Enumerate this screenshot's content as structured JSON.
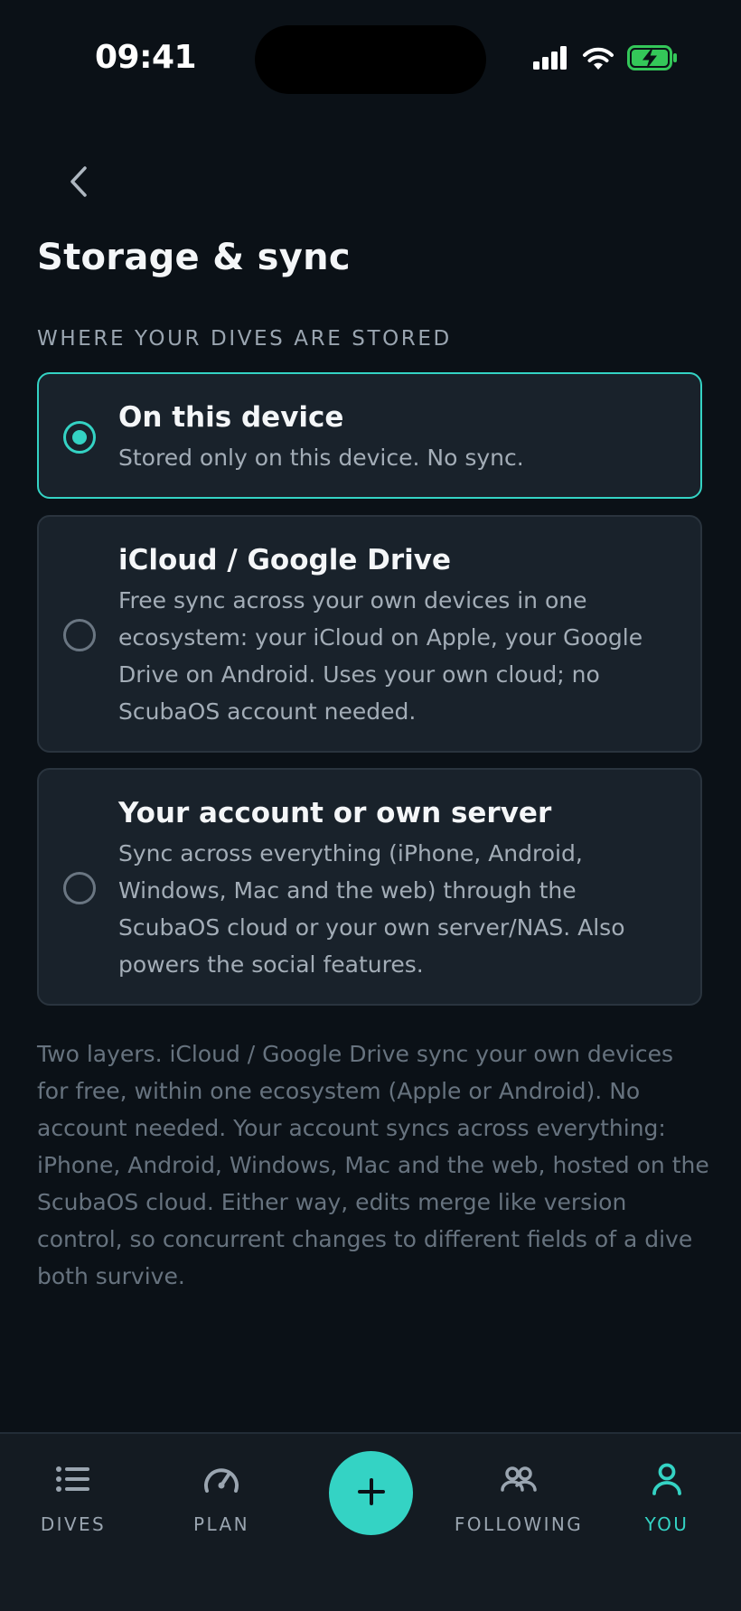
{
  "status_bar": {
    "time": "09:41"
  },
  "header": {
    "back_icon": "chevron-left-icon",
    "title": "Storage & sync"
  },
  "section": {
    "label": "WHERE YOUR DIVES ARE STORED"
  },
  "options": [
    {
      "title": "On this device",
      "description": "Stored only on this device. No sync.",
      "selected": true
    },
    {
      "title": "iCloud / Google Drive",
      "description": "Free sync across your own devices in one ecosystem: your iCloud on Apple, your Google Drive on Android. Uses your own cloud; no ScubaOS account needed.",
      "selected": false
    },
    {
      "title": "Your account or own server",
      "description": "Sync across everything (iPhone, Android, Windows, Mac and the web) through the ScubaOS cloud or your own server/NAS. Also powers the social features.",
      "selected": false
    }
  ],
  "footer_note": "Two layers. iCloud / Google Drive sync your own devices for free, within one ecosystem (Apple or Android). No account needed. Your account syncs across everything: iPhone, Android, Windows, Mac and the web, hosted on the ScubaOS cloud. Either way, edits merge like version control, so concurrent changes to different fields of a dive both survive.",
  "tab_bar": {
    "tabs": [
      {
        "label": "DIVES",
        "icon": "list-icon",
        "active": false
      },
      {
        "label": "PLAN",
        "icon": "gauge-icon",
        "active": false
      },
      {
        "label": "FOLLOWING",
        "icon": "people-icon",
        "active": false
      },
      {
        "label": "YOU",
        "icon": "person-icon",
        "active": true
      }
    ],
    "add_icon": "plus-icon"
  },
  "colors": {
    "background": "#0b1117",
    "card": "#19222b",
    "accent": "#34d3c4",
    "text_secondary": "#a3adb7",
    "text_muted": "#67737f",
    "battery": "#34c759"
  }
}
